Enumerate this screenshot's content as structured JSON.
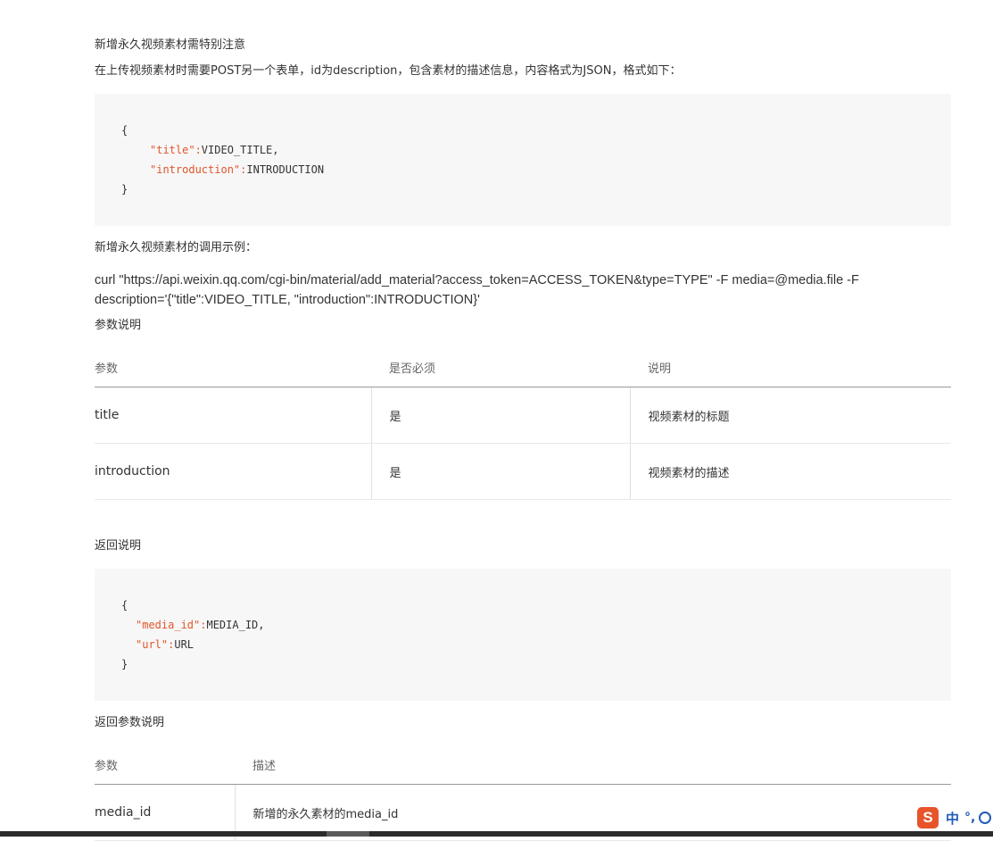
{
  "intro_heading": "新增永久视频素材需特别注意",
  "intro_text": "在上传视频素材时需要POST另一个表单，id为description，包含素材的描述信息，内容格式为JSON，格式如下：",
  "code1": {
    "open": "{",
    "title_key": "\"title\":",
    "title_val": "VIDEO_TITLE,",
    "intro_key": "\"introduction\":",
    "intro_val": "INTRODUCTION",
    "close": "}"
  },
  "example_heading": "新增永久视频素材的调用示例：",
  "curl_command": "curl \"https://api.weixin.qq.com/cgi-bin/material/add_material?access_token=ACCESS_TOKEN&type=TYPE\" -F media=@media.file -F description='{\"title\":VIDEO_TITLE, \"introduction\":INTRODUCTION}'",
  "params_heading": "参数说明",
  "params_table": {
    "headers": [
      "参数",
      "是否必须",
      "说明"
    ],
    "rows": [
      [
        "title",
        "是",
        "视频素材的标题"
      ],
      [
        "introduction",
        "是",
        "视频素材的描述"
      ]
    ]
  },
  "return_heading": "返回说明",
  "code2": {
    "open": "{",
    "media_key": "\"media_id\":",
    "media_val": "MEDIA_ID,",
    "url_key": "\"url\":",
    "url_val": "URL",
    "close": "}"
  },
  "return_params_heading": "返回参数说明",
  "return_table": {
    "headers": [
      "参数",
      "描述"
    ],
    "rows": [
      [
        "media_id",
        "新增的永久素材的media_id"
      ]
    ]
  },
  "ime": {
    "logo": "S",
    "mode": "中",
    "punct": "°,"
  },
  "colors": {
    "code_string": "#e1552a",
    "code_bg": "#f7f7f7",
    "ime_logo": "#e8542a",
    "ime_text": "#1f5bb8"
  }
}
